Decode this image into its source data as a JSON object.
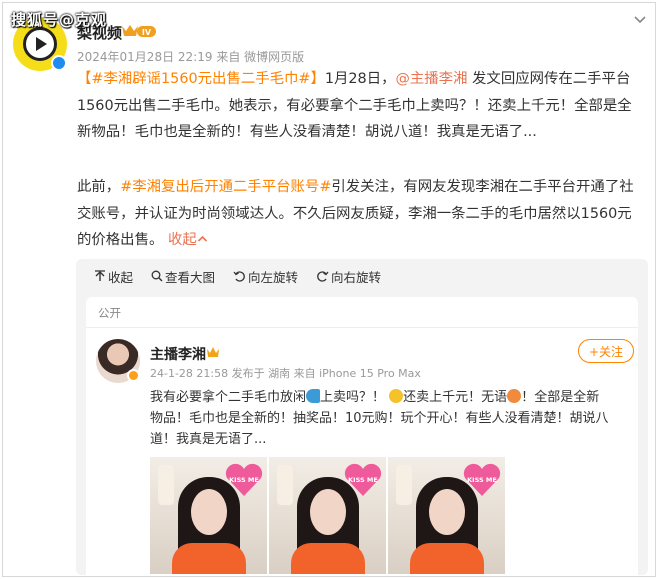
{
  "watermark": "搜狐号@克观",
  "post": {
    "author": "梨视频",
    "level_badge": "IV",
    "timestamp": "2024年01月28日 22:19",
    "source": "来自 微博网页版",
    "p1": {
      "bracket_open": "【",
      "hashtag": "#李湘辟谣1560元出售二手毛巾#",
      "bracket_close": "】",
      "date": "1月28日，",
      "mention": "@主播李湘",
      "rest": " 发文回应网传在二手平台1560元出售二手毛巾。她表示，有必要拿个二手毛巾上卖吗？！还卖上千元！全部是全新物品！毛巾也是全新的！有些人没看清楚！胡说八道！我真是无语了..."
    },
    "p2": {
      "lead": "此前，",
      "hashtag": "#李湘复出后开通二手平台账号#",
      "rest": "引发关注，有网友发现李湘在二手平台开通了社交账号，并认证为时尚领域达人。不久后网友质疑，李湘一条二手的毛巾居然以1560元的价格出售。",
      "collapse": "收起"
    }
  },
  "toolbar": {
    "collapse": "收起",
    "view_large": "查看大图",
    "rotate_left": "向左旋转",
    "rotate_right": "向右旋转"
  },
  "screenshot": {
    "visibility": "公开",
    "author": "主播李湘",
    "meta": "24-1-28 21:58 发布于 湖南 来自 iPhone 15 Pro Max",
    "follow": "+关注",
    "text_a": "我有必要拿个二手毛巾放闲",
    "text_b": "上卖吗？！",
    "text_c": "还卖上千元！无语",
    "text_d": "！全部是全新物品！毛巾也是全新的！抽奖品！10元购！玩个开心！有些人没看清楚！胡说八道！我真是无语了...",
    "thumb_sign": "KISS ME"
  },
  "colors": {
    "accent": "#ff8200",
    "mention": "#eb7350",
    "verify": "#1f8cf0"
  }
}
